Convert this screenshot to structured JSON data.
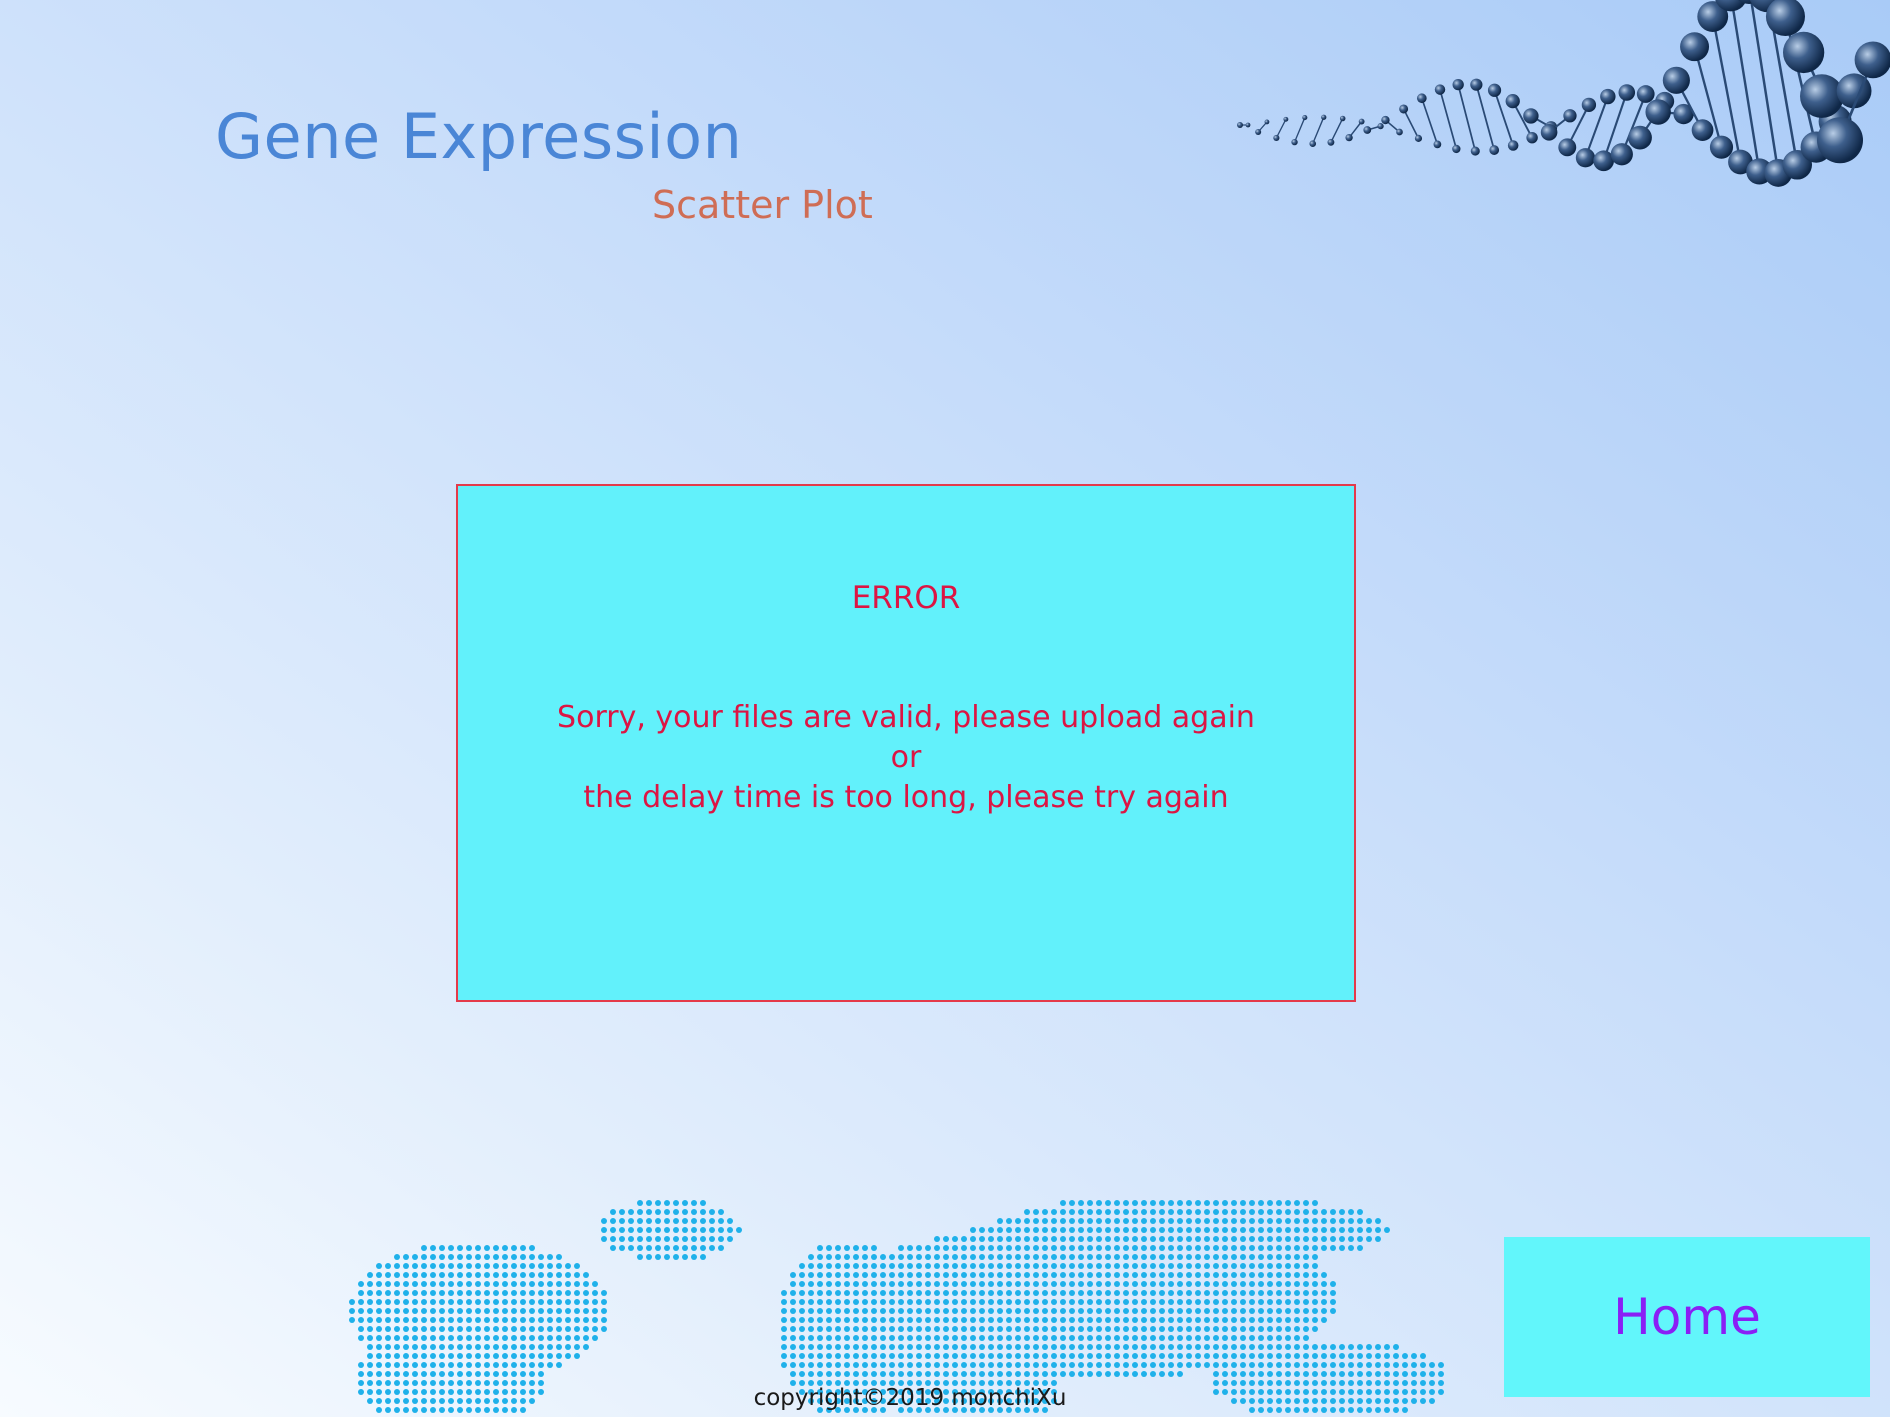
{
  "header": {
    "title": "Gene Expression",
    "subtitle": "Scatter Plot"
  },
  "error": {
    "title": "ERROR",
    "line1": "Sorry, your files are valid, please upload again",
    "line2": "or",
    "line3": "the delay time is too long, please try again"
  },
  "nav": {
    "home_label": "Home"
  },
  "footer": {
    "copyright": "copyright©2019 monchiXu"
  },
  "decorations": {
    "dna_icon": "dna-helix-icon",
    "map_icon": "dotted-world-map-icon"
  },
  "colors": {
    "title": "#4a86d6",
    "subtitle": "#cf6d55",
    "error_box_bg": "#62f1fb",
    "error_box_border": "#e43a4a",
    "error_text": "#dc1543",
    "home_bg": "#62f6fb",
    "home_text": "#8a1ff5",
    "map_dots": "#1fb1ea"
  }
}
